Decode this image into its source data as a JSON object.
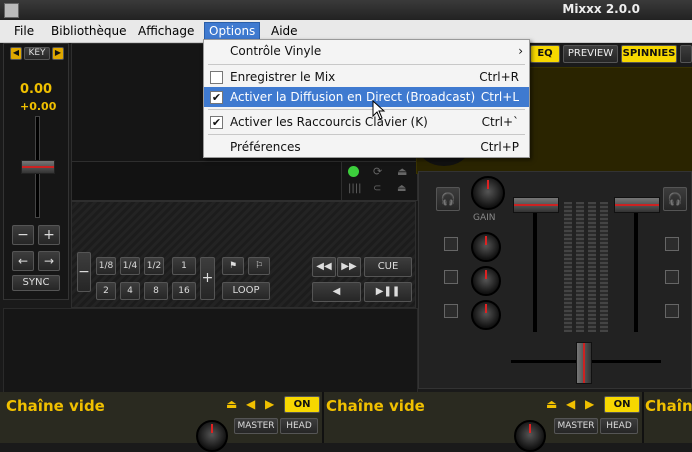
{
  "window": {
    "title": "Mixxx 2.0.0"
  },
  "menubar": {
    "items": [
      "File",
      "Bibliothèque",
      "Affichage",
      "Options",
      "Aide"
    ],
    "mnemonics": [
      "F",
      "B",
      "A",
      "O",
      "A"
    ]
  },
  "options_menu": {
    "items": [
      {
        "label": "Contrôle Vinyle",
        "shortcut": "",
        "submenu": true,
        "checkbox": false,
        "checked": false,
        "highlighted": false
      },
      {
        "label": "Enregistrer le Mix",
        "shortcut": "Ctrl+R",
        "submenu": false,
        "checkbox": true,
        "checked": false,
        "highlighted": false
      },
      {
        "label": "Activer la Diffusion en Direct (Broadcast)",
        "shortcut": "Ctrl+L",
        "submenu": false,
        "checkbox": true,
        "checked": true,
        "highlighted": true
      },
      {
        "label": "Activer les Raccourcis Clavier (K)",
        "shortcut": "Ctrl+`",
        "submenu": false,
        "checkbox": true,
        "checked": true,
        "highlighted": false
      },
      {
        "label": "Préférences",
        "shortcut": "Ctrl+P",
        "submenu": false,
        "checkbox": false,
        "checked": false,
        "highlighted": false
      }
    ]
  },
  "deck1": {
    "key_label": "KEY",
    "rate": "0.00",
    "rate_offset": "+0.00",
    "sync_label": "SYNC",
    "beatloop_buttons": [
      "1/8",
      "1/4",
      "1/2",
      "1",
      "2",
      "4",
      "8",
      "16"
    ],
    "loop_label": "LOOP",
    "cue_label": "CUE"
  },
  "top_buttons": {
    "eq": "EQ",
    "preview": "PREVIEW",
    "spinnies": "SPINNIES"
  },
  "mixer": {
    "gain_label": "GAIN"
  },
  "effects": {
    "chain1": {
      "title": "Chaîne vide",
      "on_label": "ON",
      "master_label": "MASTER",
      "head_label": "HEAD"
    },
    "chain2": {
      "title": "Chaîne vide",
      "on_label": "ON",
      "master_label": "MASTER",
      "head_label": "HEAD"
    },
    "chain3": {
      "title": "Chaîne"
    }
  },
  "colors": {
    "accent": "#f7d800",
    "menu_highlight": "#3f7ad0",
    "rate_color": "#f0c000"
  }
}
